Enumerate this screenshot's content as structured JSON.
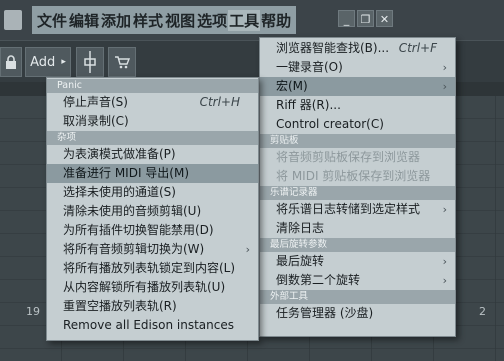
{
  "main_menu": [
    "文件",
    "编辑",
    "添加",
    "样式",
    "视图",
    "选项",
    "工具",
    "帮助"
  ],
  "window_buttons": [
    "_",
    "❐",
    "✕"
  ],
  "toolbar": {
    "add_label": "Add"
  },
  "timeline": {
    "bar_numbers": [
      "19",
      "2"
    ]
  },
  "left_menu": {
    "sections": [
      {
        "header": "Panic",
        "items": [
          {
            "label": "停止声音(S)",
            "shortcut": "Ctrl+H"
          },
          {
            "label": "取消录制(C)"
          }
        ]
      },
      {
        "header": "杂项",
        "items": [
          {
            "label": "为表演模式做准备(P)"
          },
          {
            "label": "准备进行 MIDI 导出(M)",
            "highlighted": true
          },
          {
            "label": "选择未使用的通道(S)"
          },
          {
            "label": "清除未使用的音频剪辑(U)"
          },
          {
            "label": "为所有插件切换智能禁用(D)"
          },
          {
            "label": "将所有音频剪辑切换为(W)",
            "submenu": true
          },
          {
            "label": "将所有播放列表轨锁定到内容(L)"
          },
          {
            "label": "从内容解锁所有播放列表轨(U)"
          },
          {
            "label": "重置空播放列表轨(R)"
          },
          {
            "label": "Remove all Edison instances"
          }
        ]
      }
    ]
  },
  "right_menu": {
    "sections": [
      {
        "header": "",
        "items": [
          {
            "label": "浏览器智能查找(B)...",
            "shortcut": "Ctrl+F"
          },
          {
            "label": "一键录音(O)",
            "submenu": true
          },
          {
            "label": "宏(M)",
            "submenu": true,
            "highlighted": true
          },
          {
            "label": "Riff 器(R)..."
          },
          {
            "label": "Control creator(C)"
          }
        ]
      },
      {
        "header": "剪贴板",
        "items": [
          {
            "label": "将音频剪贴板保存到浏览器",
            "disabled": true
          },
          {
            "label": "将 MIDI 剪贴板保存到浏览器",
            "disabled": true
          }
        ]
      },
      {
        "header": "乐谱记录器",
        "items": [
          {
            "label": "将乐谱日志转储到选定样式",
            "submenu": true
          },
          {
            "label": "清除日志"
          }
        ]
      },
      {
        "header": "最后旋转参数",
        "items": [
          {
            "label": "最后旋转",
            "submenu": true
          },
          {
            "label": "倒数第二个旋转",
            "submenu": true
          }
        ]
      },
      {
        "header": "外部工具",
        "items": [
          {
            "label": "任务管理器 (沙盘)"
          }
        ]
      }
    ]
  }
}
